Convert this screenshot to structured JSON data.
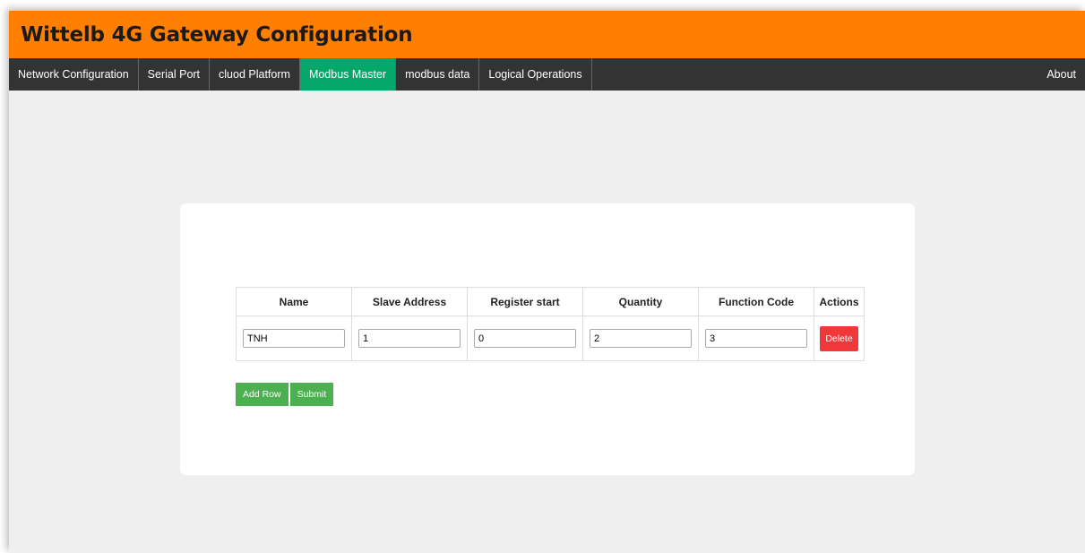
{
  "header": {
    "title": "Wittelb 4G Gateway Configuration"
  },
  "nav": {
    "items": [
      {
        "label": "Network Configuration",
        "active": false
      },
      {
        "label": "Serial Port",
        "active": false
      },
      {
        "label": "cluod Platform",
        "active": false
      },
      {
        "label": "Modbus Master",
        "active": true
      },
      {
        "label": "modbus data",
        "active": false
      },
      {
        "label": "Logical Operations",
        "active": false
      }
    ],
    "about": "About"
  },
  "table": {
    "columns": [
      "Name",
      "Slave Address",
      "Register start",
      "Quantity",
      "Function Code",
      "Actions"
    ],
    "rows": [
      {
        "name": "TNH",
        "slave_address": "1",
        "register_start": "0",
        "quantity": "2",
        "function_code": "3",
        "action": "Delete"
      }
    ]
  },
  "buttons": {
    "add_row": "Add Row",
    "submit": "Submit"
  },
  "colors": {
    "header_bg": "#ff7f00",
    "nav_bg": "#333333",
    "nav_active": "#05a86b",
    "delete_btn": "#f0373a",
    "green_btn": "#4caf50"
  }
}
